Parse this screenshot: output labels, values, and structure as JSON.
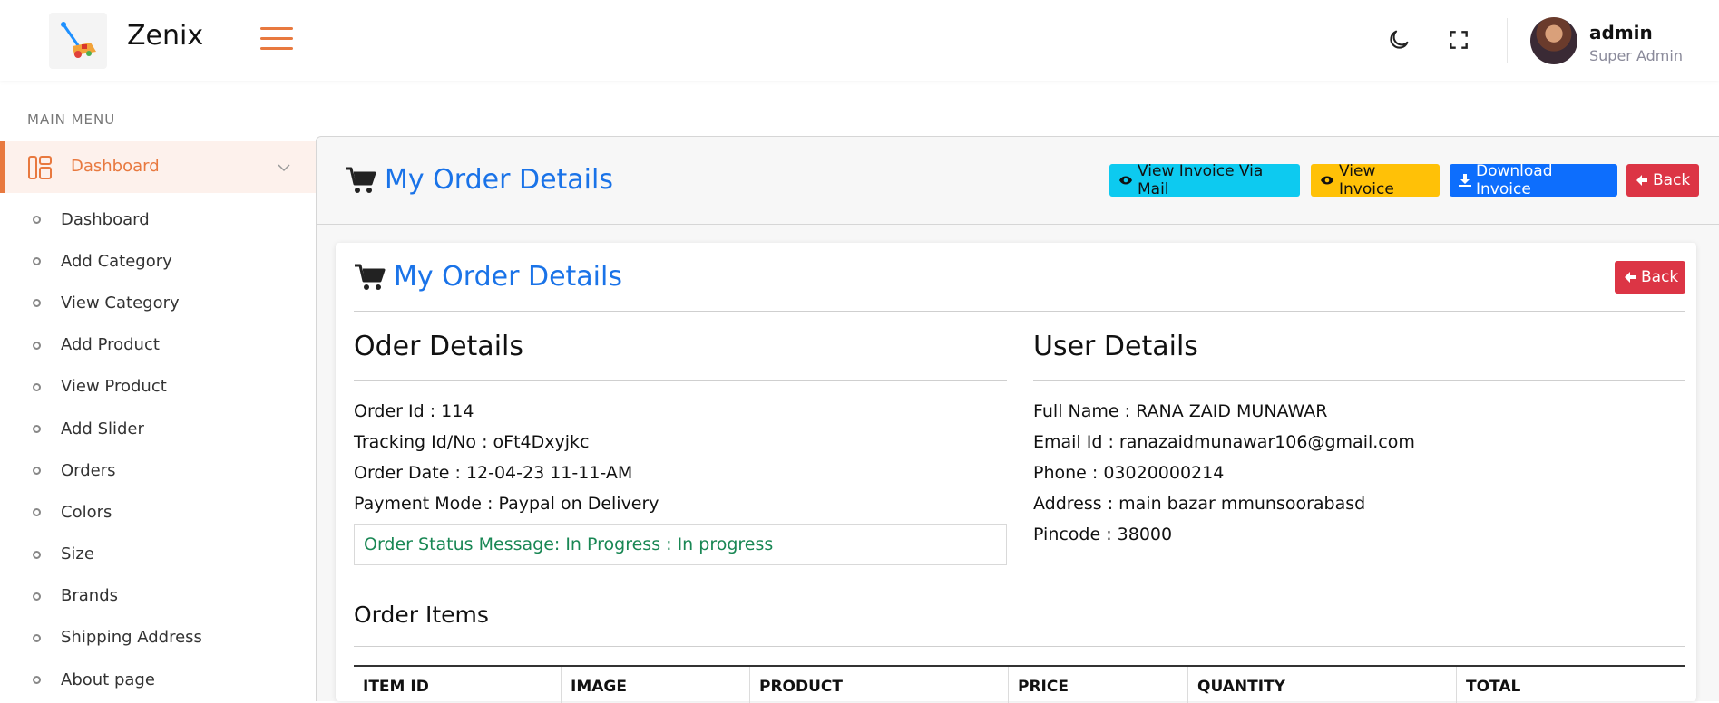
{
  "app": {
    "brand": "Zenix"
  },
  "header": {
    "user_name": "admin",
    "user_role": "Super Admin"
  },
  "sidebar": {
    "menu_title": "MAIN MENU",
    "active_item": "Dashboard",
    "items": [
      {
        "label": "Dashboard"
      },
      {
        "label": "Add Category"
      },
      {
        "label": "View Category"
      },
      {
        "label": "Add Product"
      },
      {
        "label": "View Product"
      },
      {
        "label": "Add Slider"
      },
      {
        "label": "Orders"
      },
      {
        "label": "Colors"
      },
      {
        "label": "Size"
      },
      {
        "label": "Brands"
      },
      {
        "label": "Shipping Address"
      },
      {
        "label": "About page"
      }
    ]
  },
  "page": {
    "title": "My Order Details",
    "buttons": {
      "mail": "View Invoice Via Mail",
      "view": "View Invoice",
      "download": "Download Invoice",
      "back": "Back"
    }
  },
  "card": {
    "title": "My Order Details",
    "back": "Back",
    "order_heading": "Oder Details",
    "user_heading": "User Details",
    "order_lines": [
      "Order Id : 114",
      "Tracking Id/No : oFt4Dxyjkc",
      "Order Date : 12-04-23 11-11-AM",
      "Payment Mode : Paypal on Delivery"
    ],
    "status_message": "Order Status Message: In Progress : In progress",
    "user_lines": [
      "Full Name : RANA ZAID MUNAWAR",
      "Email Id : ranazaidmunawar106@gmail.com",
      "Phone : 03020000214",
      "Address : main bazar mmunsoorabasd",
      "Pincode : 38000"
    ],
    "items_heading": "Order Items",
    "table_columns": [
      "ITEM ID",
      "IMAGE",
      "PRODUCT",
      "PRICE",
      "QUANTITY",
      "TOTAL"
    ]
  },
  "colors": {
    "accent": "#e8793f",
    "link_blue": "#1a73e8",
    "success": "#198754",
    "danger": "#dc3545"
  }
}
